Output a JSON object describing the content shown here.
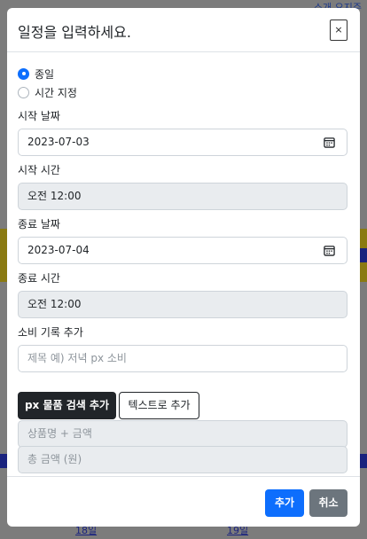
{
  "background": {
    "top_links": "소개  요지주",
    "bottom_links": [
      "18일",
      "19일"
    ]
  },
  "modal": {
    "title": "일정을 입력하세요.",
    "close_label": "×",
    "options": [
      {
        "label": "종일",
        "checked": true
      },
      {
        "label": "시간 지정",
        "checked": false
      }
    ],
    "start_date": {
      "label": "시작 날짜",
      "value": "2023-07-03"
    },
    "start_time": {
      "label": "시작 시간",
      "value": "오전 12:00"
    },
    "end_date": {
      "label": "종료 날짜",
      "value": "2023-07-04"
    },
    "end_time": {
      "label": "종료 시간",
      "value": "오전 12:00"
    },
    "expense": {
      "label": "소비 기록 추가",
      "placeholder": "제목 예) 저녁 px 소비"
    },
    "search_button": "px 물품 검색 추가",
    "text_button": "텍스트로 추가",
    "product_placeholder": "상품명 + 금액",
    "total_placeholder": "총 금액 (원)",
    "footer": {
      "add_label": "추가",
      "cancel_label": "취소"
    }
  },
  "colors": {
    "primary": "#0d6efd",
    "secondary": "#6c757d",
    "dark": "#212529"
  }
}
